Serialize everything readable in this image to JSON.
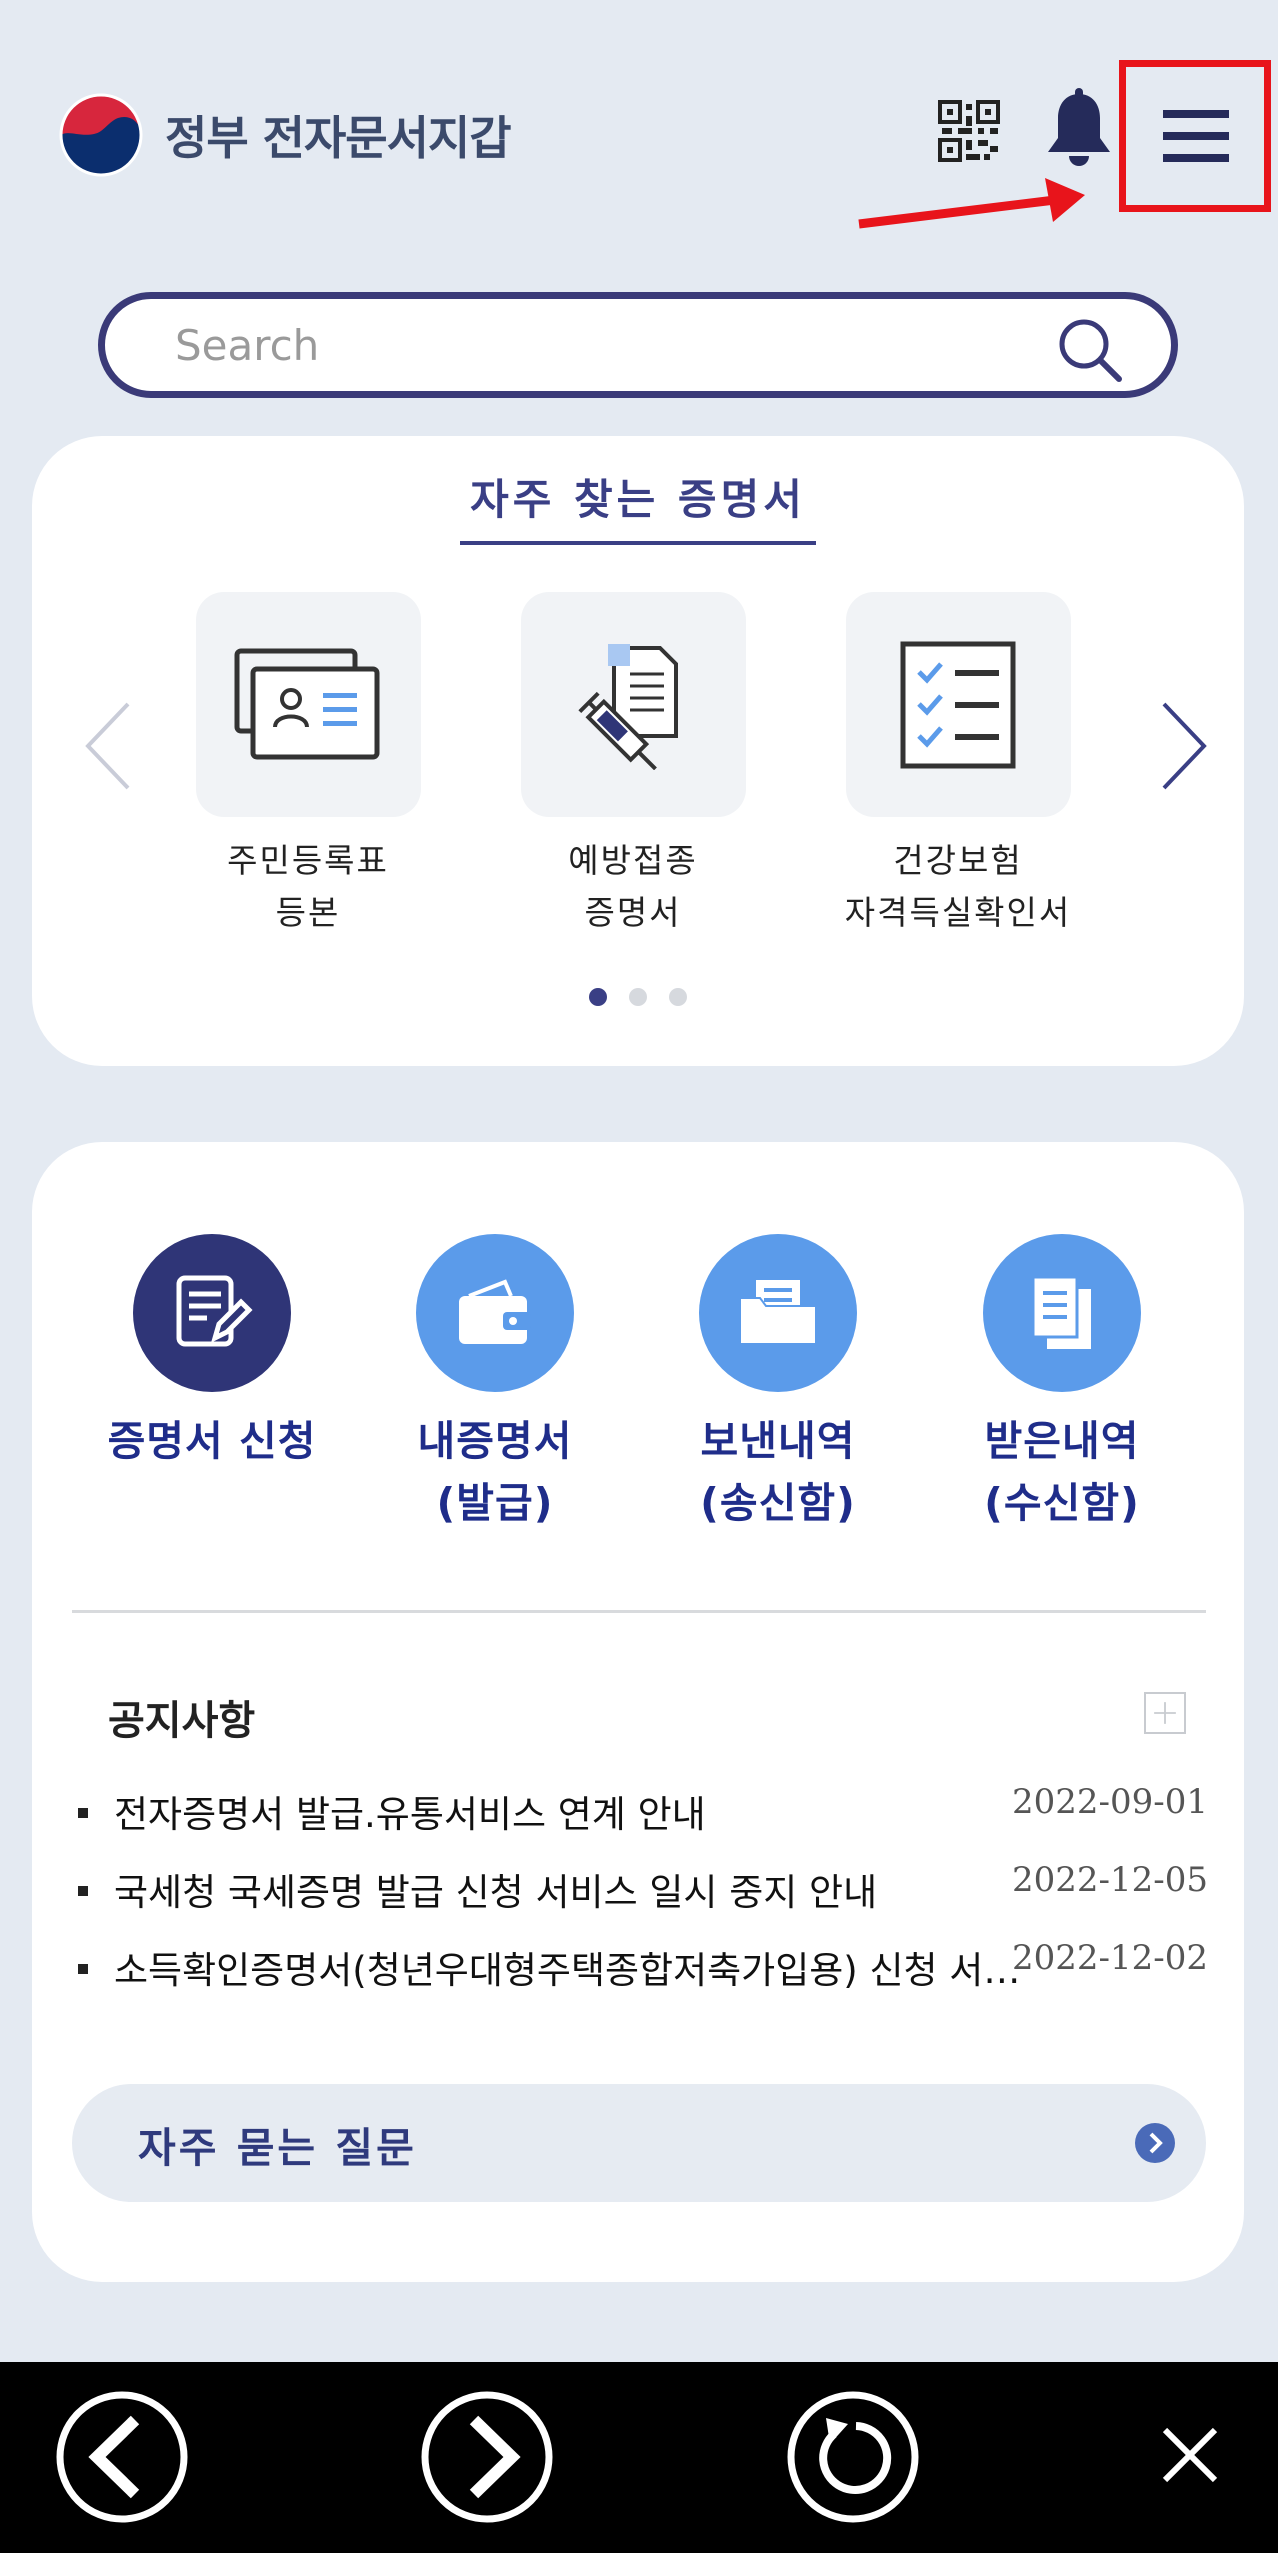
{
  "header": {
    "title": "정부 전자문서지갑",
    "icons": [
      "government-logo",
      "qr-code-icon",
      "bell-icon",
      "hamburger-menu-icon"
    ]
  },
  "search": {
    "placeholder": "Search"
  },
  "frequent": {
    "title": "자주 찾는 증명서",
    "items": [
      {
        "label": "주민등록표\n등본",
        "icon": "id-card-icon"
      },
      {
        "label": "예방접종\n증명서",
        "icon": "vaccine-syringe-icon"
      },
      {
        "label": "건강보험\n자격득실확인서",
        "icon": "checklist-icon"
      }
    ],
    "page_count": 3,
    "active_page": 1
  },
  "quick_menu": [
    {
      "label": "증명서 신청",
      "icon": "edit-document-icon",
      "color": "#2f3577"
    },
    {
      "label": "내증명서\n(발급)",
      "icon": "wallet-icon",
      "color": "#5b9bea"
    },
    {
      "label": "보낸내역\n(송신함)",
      "icon": "folder-icon",
      "color": "#5b9bea"
    },
    {
      "label": "받은내역\n(수신함)",
      "icon": "documents-icon",
      "color": "#5b9bea"
    }
  ],
  "notices": {
    "title": "공지사항",
    "items": [
      {
        "text": "전자증명서 발급.유통서비스 연계 안내",
        "date": "2022-09-01"
      },
      {
        "text": "국세청 국세증명 발급 신청 서비스 일시 중지 안내",
        "date": "2022-12-05"
      },
      {
        "text": "소득확인증명서(청년우대형주택종합저축가입용) 신청 서비스 안내",
        "date": "2022-12-02"
      }
    ]
  },
  "faq": {
    "label": "자주 묻는 질문"
  },
  "colors": {
    "accent": "#3a3f85",
    "highlight": "#e8141b",
    "light_blue": "#5b9bea"
  }
}
